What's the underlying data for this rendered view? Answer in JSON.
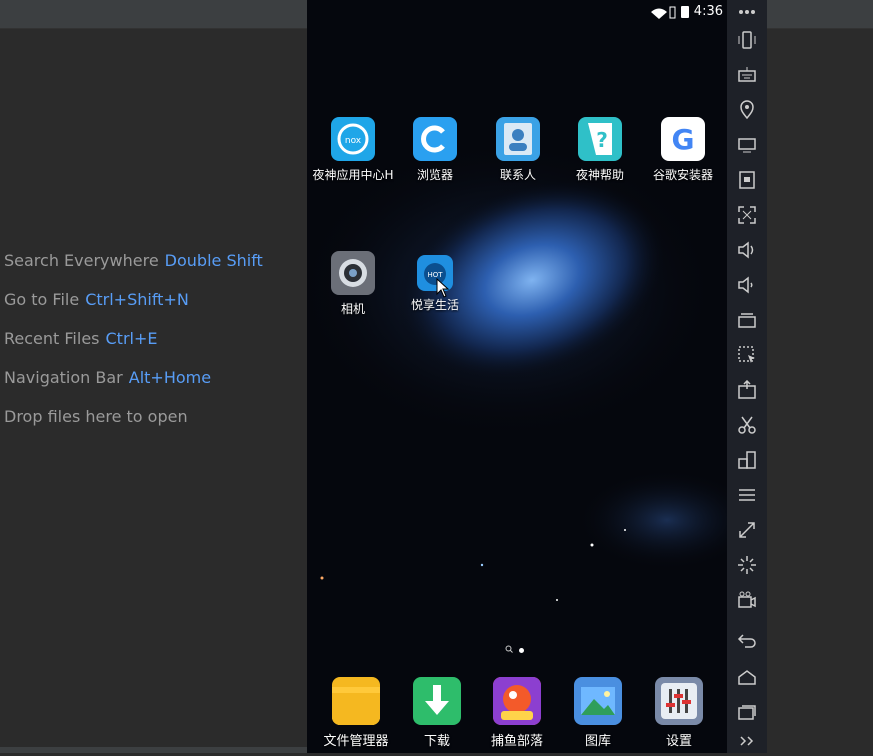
{
  "status_bar": {
    "time": "4:36"
  },
  "ide_hints": [
    {
      "label": "Search Everywhere",
      "key": "Double Shift"
    },
    {
      "label": "Go to File",
      "key": "Ctrl+Shift+N"
    },
    {
      "label": "Recent Files",
      "key": "Ctrl+E"
    },
    {
      "label": "Navigation Bar",
      "key": "Alt+Home"
    },
    {
      "label": "Drop files here to open",
      "key": ""
    }
  ],
  "home_apps": [
    {
      "label": "夜神应用中心H",
      "icon": "nox-app-center-icon",
      "color": "#1fa6e8"
    },
    {
      "label": "浏览器",
      "icon": "browser-icon",
      "color": "#2aa0f0"
    },
    {
      "label": "联系人",
      "icon": "contacts-icon",
      "color": "#3ba2e6"
    },
    {
      "label": "夜神帮助",
      "icon": "help-icon",
      "color": "#2fc0c8"
    },
    {
      "label": "谷歌安装器",
      "icon": "google-installer-icon",
      "color": "#ffffff"
    },
    {
      "label": "相机",
      "icon": "camera-icon",
      "color": "#6b6f78"
    },
    {
      "label": "悦享生活",
      "icon": "hot-life-icon",
      "color": "#1f8fe0"
    }
  ],
  "dock_apps": [
    {
      "label": "文件管理器",
      "icon": "file-manager-icon",
      "color": "#f5b820"
    },
    {
      "label": "下载",
      "icon": "download-icon",
      "color": "#2ebd6b"
    },
    {
      "label": "捕鱼部落",
      "icon": "fishing-game-icon",
      "color": "#e8503a"
    },
    {
      "label": "图库",
      "icon": "gallery-icon",
      "color": "#4a8fe0"
    },
    {
      "label": "设置",
      "icon": "settings-icon",
      "color": "#7a8aa8"
    }
  ],
  "sidebar_tools": [
    "more-icon",
    "shake-icon",
    "keyboard-icon",
    "location-icon",
    "screen-icon",
    "toolbox-icon",
    "fullscreen-icon",
    "volume-up-icon",
    "volume-down-icon",
    "multi-instance-icon",
    "screenshot-icon",
    "apk-install-icon",
    "scissors-icon",
    "layout-icon",
    "menu-icon",
    "resize-icon",
    "loading-icon",
    "record-icon",
    "back-icon",
    "home-icon",
    "recents-icon",
    "expand-icon"
  ]
}
